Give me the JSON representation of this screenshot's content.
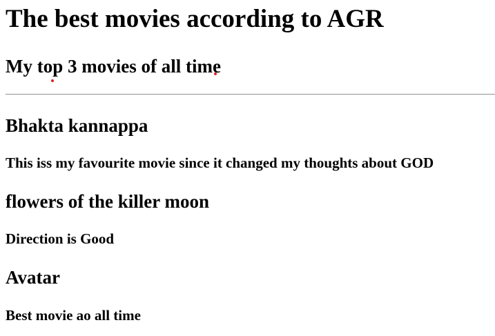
{
  "page": {
    "title": "The best movies according to AGR",
    "subtitle": "My top 3 movies of all time"
  },
  "movies": [
    {
      "title": "Bhakta kannappa",
      "description": "This iss my favourite movie since it changed my thoughts about GOD"
    },
    {
      "title": "flowers of the killer moon",
      "description": "Direction is Good"
    },
    {
      "title": "Avatar",
      "description": "Best movie ao all time"
    }
  ],
  "colors": {
    "text": "#000000",
    "background": "#ffffff",
    "rule": "#9a9a9a",
    "spellcheck_marker": "#e02020"
  }
}
